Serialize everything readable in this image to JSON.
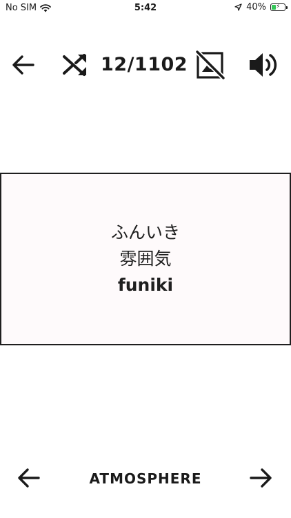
{
  "status_bar": {
    "carrier": "No SIM",
    "time": "5:42",
    "battery_percent": "40%",
    "battery_level": 0.4,
    "battery_color": "#35c759",
    "icons": [
      "wifi-icon",
      "location-arrow-icon",
      "battery-charging-icon"
    ]
  },
  "toolbar": {
    "counter": "12/1102",
    "icons": [
      "back-arrow-icon",
      "shuffle-icon",
      "image-off-icon",
      "speaker-icon"
    ]
  },
  "card": {
    "kana": "ふんいき",
    "kanji": "雰囲気",
    "romaji": "funiki",
    "background": "#fefafb"
  },
  "bottom_nav": {
    "meaning": "ATMOSPHERE",
    "icons": [
      "previous-arrow-icon",
      "next-arrow-icon"
    ]
  }
}
